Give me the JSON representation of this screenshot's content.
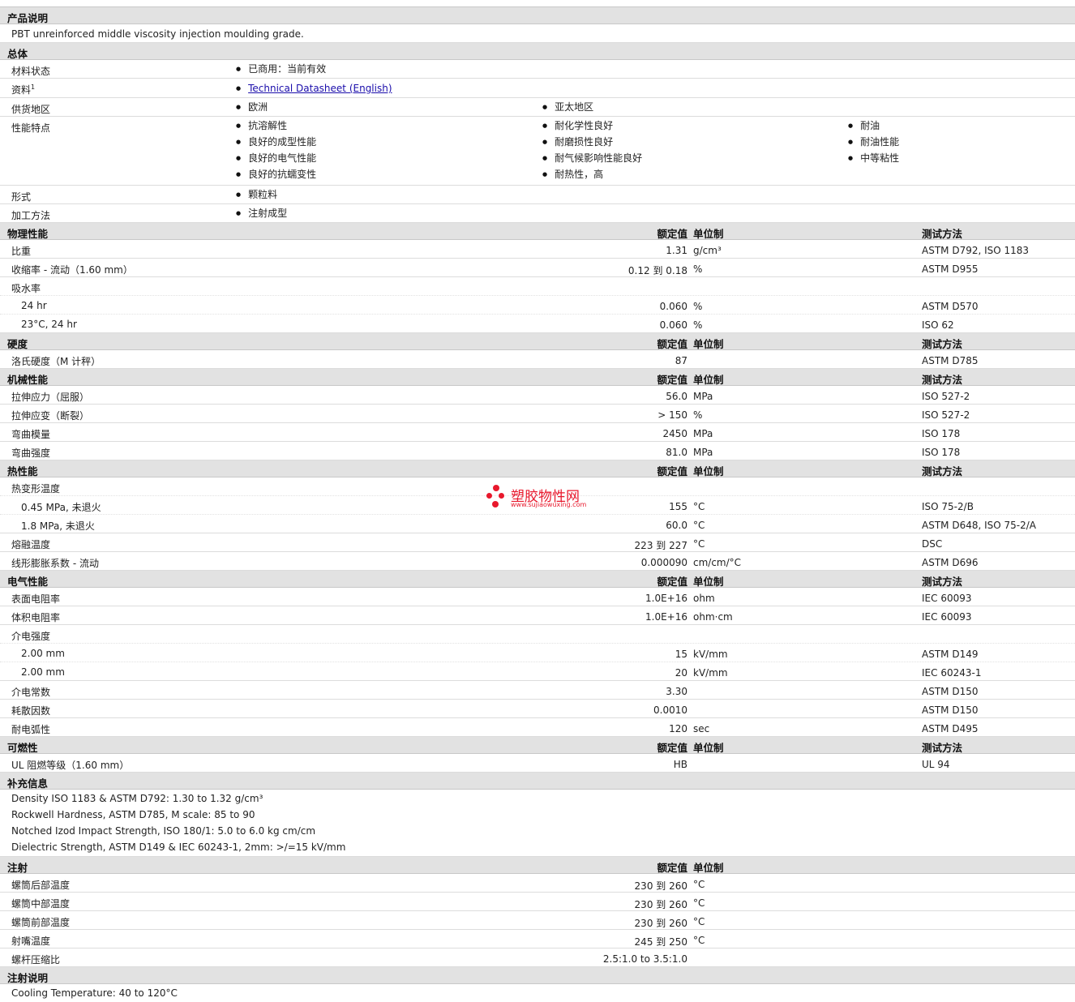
{
  "product_desc": {
    "title": "产品说明",
    "text": "PBT unreinforced middle viscosity injection moulding grade."
  },
  "general": {
    "title": "总体",
    "material_status_label": "材料状态",
    "material_status": "已商用：当前有效",
    "literature_label": "资料",
    "literature_sup": "1",
    "literature_link": "Technical Datasheet (English)",
    "availability_label": "供货地区",
    "availability": [
      "欧洲",
      "亚太地区"
    ],
    "features_label": "性能特点",
    "features_col1": [
      "抗溶解性",
      "良好的成型性能",
      "良好的电气性能",
      "良好的抗蠕变性"
    ],
    "features_col2": [
      "耐化学性良好",
      "耐磨损性良好",
      "耐气候影响性能良好",
      "耐热性，高"
    ],
    "features_col3": [
      "耐油",
      "耐油性能",
      "中等粘性"
    ],
    "forms_label": "形式",
    "forms": "颗粒料",
    "processing_label": "加工方法",
    "processing": "注射成型"
  },
  "headers": {
    "value": "额定值",
    "unit": "单位制",
    "method": "测试方法"
  },
  "physical": {
    "title": "物理性能",
    "specific_gravity": {
      "name": "比重",
      "value": "1.31",
      "unit": "g/cm³",
      "method": "ASTM D792, ISO 1183"
    },
    "shrinkage": {
      "name": "收缩率  - 流动（1.60 mm）",
      "value": "0.12 到  0.18",
      "unit": "%",
      "method": "ASTM D955"
    },
    "water_absorption": "吸水率",
    "wa_24hr": {
      "name": "24 hr",
      "value": "0.060",
      "unit": "%",
      "method": "ASTM D570"
    },
    "wa_23c": {
      "name": "23°C, 24 hr",
      "value": "0.060",
      "unit": "%",
      "method": "ISO 62"
    }
  },
  "hardness": {
    "title": "硬度",
    "rockwell": {
      "name": "洛氏硬度（M 计秤）",
      "value": "87",
      "method": "ASTM D785"
    }
  },
  "mechanical": {
    "title": "机械性能",
    "tensile_stress": {
      "name": "拉伸应力（屈服）",
      "value": "56.0",
      "unit": "MPa",
      "method": "ISO 527-2"
    },
    "tensile_strain": {
      "name": "拉伸应变（断裂）",
      "value": "> 150",
      "unit": "%",
      "method": "ISO 527-2"
    },
    "flex_modulus": {
      "name": "弯曲模量",
      "value": "2450",
      "unit": "MPa",
      "method": "ISO 178"
    },
    "flex_strength": {
      "name": "弯曲强度",
      "value": "81.0",
      "unit": "MPa",
      "method": "ISO 178"
    }
  },
  "thermal": {
    "title": "热性能",
    "hdt": "热变形温度",
    "hdt_045": {
      "name": "0.45 MPa, 未退火",
      "value": "155",
      "unit": "°C",
      "method": "ISO 75-2/B"
    },
    "hdt_18": {
      "name": "1.8 MPa, 未退火",
      "value": "60.0",
      "unit": "°C",
      "method": "ASTM D648, ISO 75-2/A"
    },
    "melting": {
      "name": "熔融温度",
      "value": "223 到  227",
      "unit": "°C",
      "method": "DSC"
    },
    "clte": {
      "name": "线形膨胀系数  - 流动",
      "value": "0.000090",
      "unit": "cm/cm/°C",
      "method": "ASTM D696"
    }
  },
  "electrical": {
    "title": "电气性能",
    "surface_res": {
      "name": "表面电阻率",
      "value": "1.0E+16",
      "unit": "ohm",
      "method": "IEC 60093"
    },
    "volume_res": {
      "name": "体积电阻率",
      "value": "1.0E+16",
      "unit": "ohm·cm",
      "method": "IEC 60093"
    },
    "dielectric_strength": "介电强度",
    "ds_1": {
      "name": "2.00 mm",
      "value": "15",
      "unit": "kV/mm",
      "method": "ASTM D149"
    },
    "ds_2": {
      "name": "2.00 mm",
      "value": "20",
      "unit": "kV/mm",
      "method": "IEC 60243-1"
    },
    "dielectric_const": {
      "name": "介电常数",
      "value": "3.30",
      "method": "ASTM D150"
    },
    "dissipation": {
      "name": "耗散因数",
      "value": "0.0010",
      "method": "ASTM D150"
    },
    "arc": {
      "name": "耐电弧性",
      "value": "120",
      "unit": "sec",
      "method": "ASTM D495"
    }
  },
  "flammability": {
    "title": "可燃性",
    "ul": {
      "name": "UL 阻燃等级（1.60 mm）",
      "value": "HB",
      "method": "UL 94"
    }
  },
  "supplemental": {
    "title": "补充信息",
    "lines": [
      "Density ISO 1183 & ASTM D792: 1.30 to 1.32 g/cm³",
      "Rockwell Hardness, ASTM D785, M scale: 85 to 90",
      "Notched Izod Impact Strength, ISO 180/1: 5.0 to 6.0 kg cm/cm",
      "Dielectric Strength, ASTM D149 & IEC 60243-1, 2mm: >/=15 kV/mm"
    ]
  },
  "injection": {
    "title": "注射",
    "rear": {
      "name": "螺筒后部温度",
      "value": "230 到  260",
      "unit": "°C"
    },
    "middle": {
      "name": "螺筒中部温度",
      "value": "230 到  260",
      "unit": "°C"
    },
    "front": {
      "name": "螺筒前部温度",
      "value": "230 到  260",
      "unit": "°C"
    },
    "nozzle": {
      "name": "射嘴温度",
      "value": "245 到  250",
      "unit": "°C"
    },
    "compression": {
      "name": "螺杆压缩比",
      "value": "2.5:1.0 to 3.5:1.0"
    }
  },
  "injection_notes": {
    "title": "注射说明",
    "text": "Cooling Temperature: 40 to 120°C"
  },
  "watermark": {
    "text": "塑胶物性网",
    "url": "www.sujiaowuxing.com",
    "color": "#e8182c"
  }
}
